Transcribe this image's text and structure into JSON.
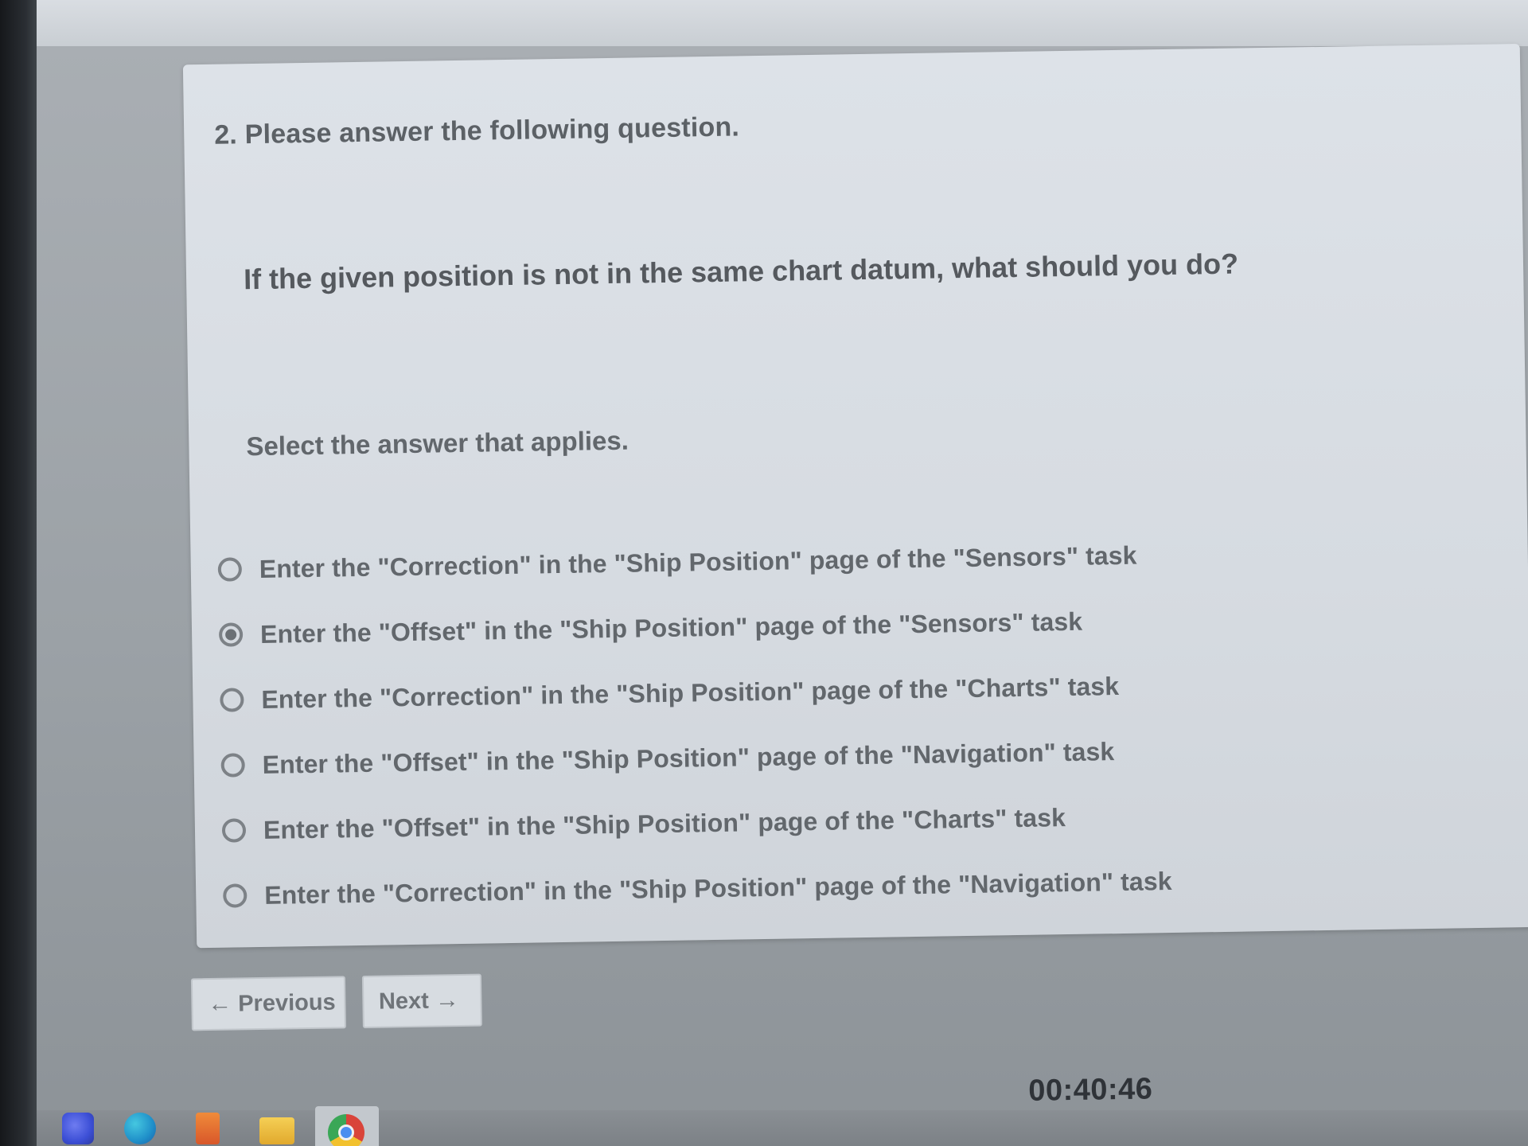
{
  "question": {
    "number_title": "2. Please answer the following question.",
    "text": "If the given position is not in the same chart datum, what should you do?",
    "instruction": "Select the answer that applies."
  },
  "options": [
    {
      "label": "Enter the \"Correction\" in the \"Ship Position\" page of the \"Sensors\" task",
      "selected": false
    },
    {
      "label": "Enter the \"Offset\" in the \"Ship Position\" page of the \"Sensors\" task",
      "selected": true
    },
    {
      "label": "Enter the \"Correction\" in the \"Ship Position\" page of the \"Charts\" task",
      "selected": false
    },
    {
      "label": "Enter the \"Offset\" in the \"Ship Position\" page of the \"Navigation\" task",
      "selected": false
    },
    {
      "label": "Enter the \"Offset\" in the \"Ship Position\" page of the \"Charts\" task",
      "selected": false
    },
    {
      "label": "Enter the \"Correction\" in the \"Ship Position\" page of the \"Navigation\" task",
      "selected": false
    }
  ],
  "navigation": {
    "previous_label": "Previous",
    "next_label": "Next",
    "previous_icon": "arrow-left-icon",
    "next_icon": "arrow-right-icon"
  },
  "timer": {
    "value": "00:40:46"
  },
  "taskbar": {
    "icons": [
      "copilot-icon",
      "edge-icon",
      "paint-icon",
      "file-explorer-icon",
      "chrome-icon"
    ]
  }
}
